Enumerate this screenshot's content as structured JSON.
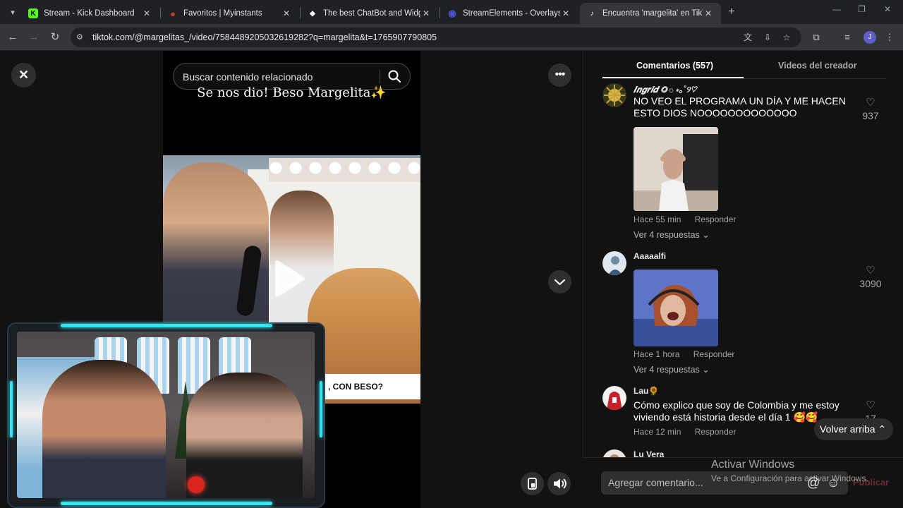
{
  "browser": {
    "tabs": [
      {
        "title": "Stream - Kick Dashboard",
        "favicon": "K",
        "favicon_color": "#53fc18"
      },
      {
        "title": "Favoritos | Myinstants",
        "favicon": "●",
        "favicon_color": "#c0392b"
      },
      {
        "title": "The best ChatBot and Widgets",
        "favicon": "◆",
        "favicon_color": "#ffffff"
      },
      {
        "title": "StreamElements - Overlays",
        "favicon": "◉",
        "favicon_color": "#4a55d6"
      },
      {
        "title": "Encuentra 'margelita' en TikTok",
        "favicon": "♪",
        "favicon_color": "#ffffff"
      }
    ],
    "url": "tiktok.com/@margelitas_/video/7584489205032619282?q=margelita&t=1765907790805",
    "profile_initial": "J"
  },
  "video": {
    "search_placeholder": "Buscar contenido relacionado",
    "caption": "Se nos dio! Beso Margelita✨",
    "banner_text": ", CON BESO?"
  },
  "panel": {
    "tabs": [
      "Comentarios (557)",
      "Videos del creador"
    ],
    "comments": [
      {
        "user": "𝑰𝒏𝒈𝒓𝒊𝒅 ◎☼⋆｡˚୨♡",
        "text": "NO VEO EL PROGRAMA UN DÍA Y ME HACEN ESTO DIOS NOOOOOOOOOOOOO",
        "time": "Hace 55 min",
        "reply": "Responder",
        "more": "Ver 4 respuestas ⌄",
        "likes": "937"
      },
      {
        "user": "Aaaaalfi",
        "text": "",
        "time": "Hace 1 hora",
        "reply": "Responder",
        "more": "Ver 4 respuestas ⌄",
        "likes": "3090"
      },
      {
        "user": "Lau🌻",
        "text": "Cómo explico que soy de Colombia y me estoy viviendo está historia desde el día 1 🥰🥰",
        "time": "Hace 12 min",
        "reply": "Responder",
        "likes": "17"
      },
      {
        "user": "Lu Vera"
      }
    ],
    "back_to_top": "Volver arriba ⌃",
    "comment_placeholder": "Agregar comentario...",
    "publish": "Publicar"
  },
  "watermark": {
    "line1": "Activar Windows",
    "line2": "Ve a Configuración para activar Windows."
  },
  "colors": {
    "accent_cyan": "#35e3ee",
    "tiktok_red": "#fe2c55"
  }
}
